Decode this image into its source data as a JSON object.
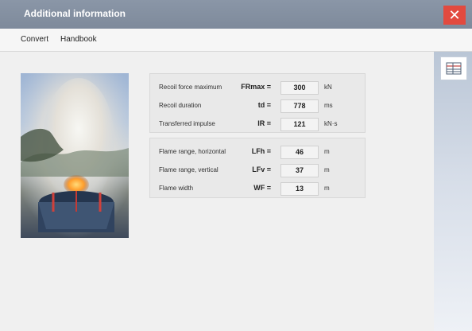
{
  "window": {
    "title": "Additional information"
  },
  "menu": {
    "items": [
      "Convert",
      "Handbook"
    ]
  },
  "recoil": {
    "rows": [
      {
        "label": "Recoil force maximum",
        "symbol": "FRmax =",
        "value": "300",
        "unit": "kN"
      },
      {
        "label": "Recoil duration",
        "symbol": "td =",
        "value": "778",
        "unit": "ms"
      },
      {
        "label": "Transferred impulse",
        "symbol": "IR =",
        "value": "121",
        "unit": "kN·s"
      }
    ]
  },
  "flame": {
    "rows": [
      {
        "label": "Flame range, horizontal",
        "symbol": "LFh =",
        "value": "46",
        "unit": "m"
      },
      {
        "label": "Flame range, vertical",
        "symbol": "LFv =",
        "value": "37",
        "unit": "m"
      },
      {
        "label": "Flame width",
        "symbol": "WF =",
        "value": "13",
        "unit": "m"
      }
    ]
  },
  "icons": {
    "close": "close-icon",
    "table": "table-icon"
  },
  "colors": {
    "titlebar": "#7e8a9b",
    "close": "#e24a3f"
  }
}
